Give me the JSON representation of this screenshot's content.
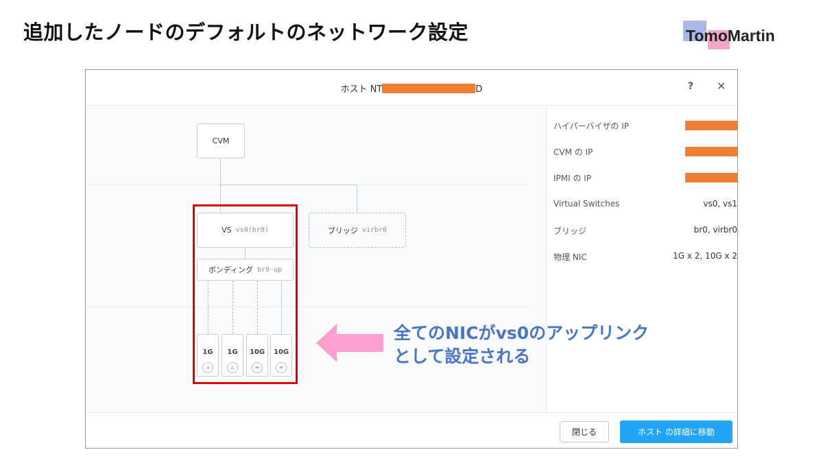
{
  "slide": {
    "title": "追加したノードのデフォルトのネットワーク設定",
    "logo_text": "TomoMartin"
  },
  "dialog": {
    "title_prefix": "ホスト NT",
    "title_suffix": "D",
    "help_label": "?",
    "close_label": "✕"
  },
  "diagram": {
    "cvm_label": "CVM",
    "vs_label": "VS",
    "vs_code": "vs0(br0)",
    "bridge_label": "ブリッジ",
    "bridge_code": "virbr0",
    "bond_label": "ボンディング",
    "bond_code": "br0-up",
    "nics": [
      {
        "speed": "1G",
        "icon": "ethernet-icon"
      },
      {
        "speed": "1G",
        "icon": "ethernet-icon"
      },
      {
        "speed": "10G",
        "icon": "sfp-icon"
      },
      {
        "speed": "10G",
        "icon": "sfp-icon"
      }
    ]
  },
  "callout": {
    "line1": "全てのNICがvs0のアップリンク",
    "line2": "として設定される",
    "color": "#4a74c9"
  },
  "properties": [
    {
      "label": "ハイパーバイザの IP",
      "value": ""
    },
    {
      "label": "CVM の IP",
      "value": ""
    },
    {
      "label": "IPMI の IP",
      "value": ""
    },
    {
      "label": "Virtual Switches",
      "value": "vs0, vs1"
    },
    {
      "label": "ブリッジ",
      "value": "br0, virbr0"
    },
    {
      "label": "物理 NIC",
      "value": "1G x 2, 10G x 2"
    }
  ],
  "footer": {
    "close_button": "閉じる",
    "detail_button": "ホスト の詳細に移動"
  },
  "colors": {
    "redaction": "#ee7f34",
    "primary_button": "#22a5f7",
    "highlight_border": "#e00000",
    "arrow": "#ff9fd0"
  }
}
